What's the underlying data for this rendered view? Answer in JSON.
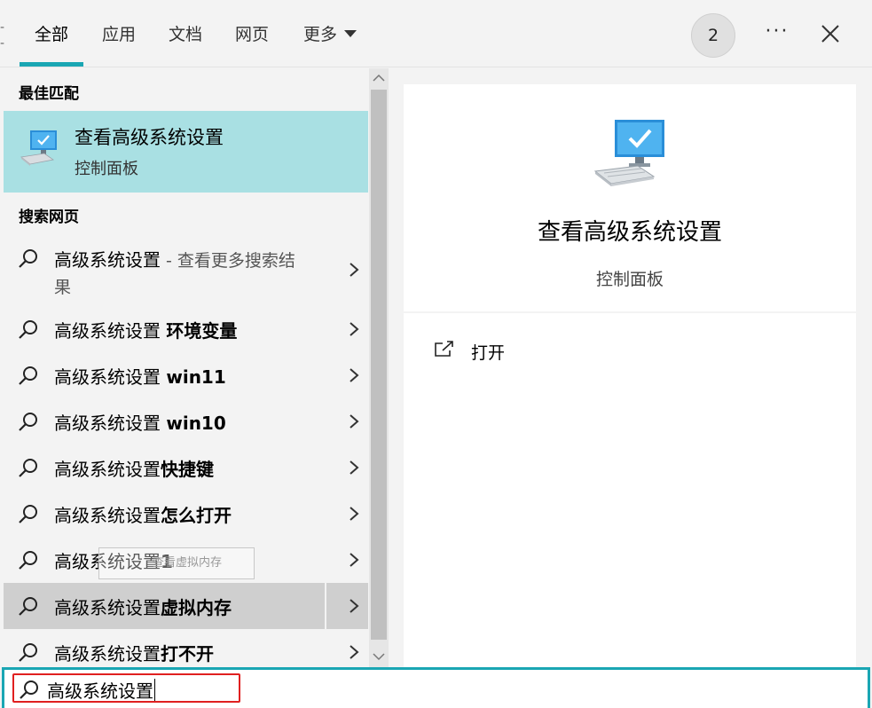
{
  "header": {
    "tabs": [
      {
        "label": "全部",
        "active": true
      },
      {
        "label": "应用"
      },
      {
        "label": "文档"
      },
      {
        "label": "网页"
      },
      {
        "label": "更多"
      }
    ],
    "badge_count": "2",
    "more_glyph": "···",
    "accent_color": "#1aa6b3"
  },
  "left": {
    "best_match_title": "最佳匹配",
    "best_match": {
      "title": "查看高级系统设置",
      "subtitle": "控制面板",
      "icon": "computer-monitor-icon",
      "bg_color": "#a9e0e3"
    },
    "web_title": "搜索网页",
    "web_items": [
      {
        "prefix": "高级系统设置",
        "muted": " - 查看更多搜索结",
        "muted2": "果",
        "bold": ""
      },
      {
        "prefix": "高级系统设置 ",
        "bold": "环境变量"
      },
      {
        "prefix": "高级系统设置 ",
        "bold": "win11"
      },
      {
        "prefix": "高级系统设置 ",
        "bold": "win10"
      },
      {
        "prefix": "高级系统设置",
        "bold": "快捷键"
      },
      {
        "prefix": "高级系统设置",
        "bold": "怎么打开"
      },
      {
        "prefix": "高级系统设置",
        "bold": "1"
      },
      {
        "prefix": "高级系统设置",
        "bold": "虚拟内存",
        "selected": true
      },
      {
        "prefix": "高级系统设置",
        "bold": "打不开"
      }
    ],
    "tooltip_ghost_text": "查看虚拟内存"
  },
  "right": {
    "title": "查看高级系统设置",
    "subtitle": "控制面板",
    "icon": "computer-monitor-icon",
    "actions": [
      {
        "label": "打开",
        "icon": "open-external-icon"
      }
    ]
  },
  "search": {
    "query": "高级系统设置",
    "icon": "search-icon",
    "highlight_color": "#e02020"
  }
}
